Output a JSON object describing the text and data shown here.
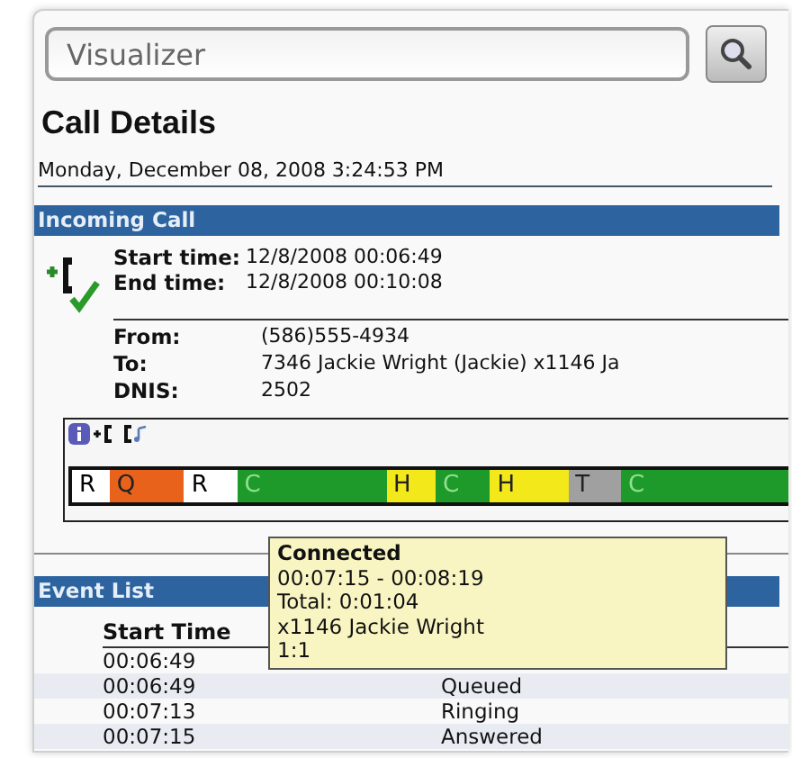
{
  "search": {
    "value": "Visualizer"
  },
  "title": "Call Details",
  "timestamp": "Monday, December 08, 2008 3:24:53 PM",
  "incoming_call": {
    "header": "Incoming Call",
    "times": [
      {
        "label": "Start time:",
        "value": "12/8/2008 00:06:49"
      },
      {
        "label": "End time:",
        "value": "12/8/2008 00:10:08"
      }
    ],
    "details": [
      {
        "label": "From:",
        "value": "(586)555-4934"
      },
      {
        "label": "To:",
        "value": "7346 Jackie Wright (Jackie) x1146 Ja"
      },
      {
        "label": "DNIS:",
        "value": "2502"
      }
    ]
  },
  "timeline": {
    "segments": [
      {
        "label": "R",
        "color": "#ffffff"
      },
      {
        "label": "Q",
        "color": "#e8621c"
      },
      {
        "label": "R",
        "color": "#ffffff"
      },
      {
        "label": "C",
        "color": "#1e9a2a"
      },
      {
        "label": "H",
        "color": "#f2e81a"
      },
      {
        "label": "C",
        "color": "#1e9a2a"
      },
      {
        "label": "H",
        "color": "#f2e81a"
      },
      {
        "label": "T",
        "color": "#a0a0a0"
      },
      {
        "label": "C",
        "color": "#1e9a2a"
      }
    ]
  },
  "tooltip": {
    "title": "Connected",
    "lines": [
      "00:07:15 - 00:08:19",
      "Total: 0:01:04",
      "x1146 Jackie Wright",
      "1:1"
    ]
  },
  "event_list": {
    "header": "Event List",
    "columns": [
      "Start Time"
    ],
    "rows": [
      {
        "start": "00:06:49"
      },
      {
        "start": "00:06:49",
        "event": "Queued"
      },
      {
        "start": "00:07:13",
        "event": "Ringing"
      },
      {
        "start": "00:07:15",
        "event": "Answered"
      }
    ]
  }
}
